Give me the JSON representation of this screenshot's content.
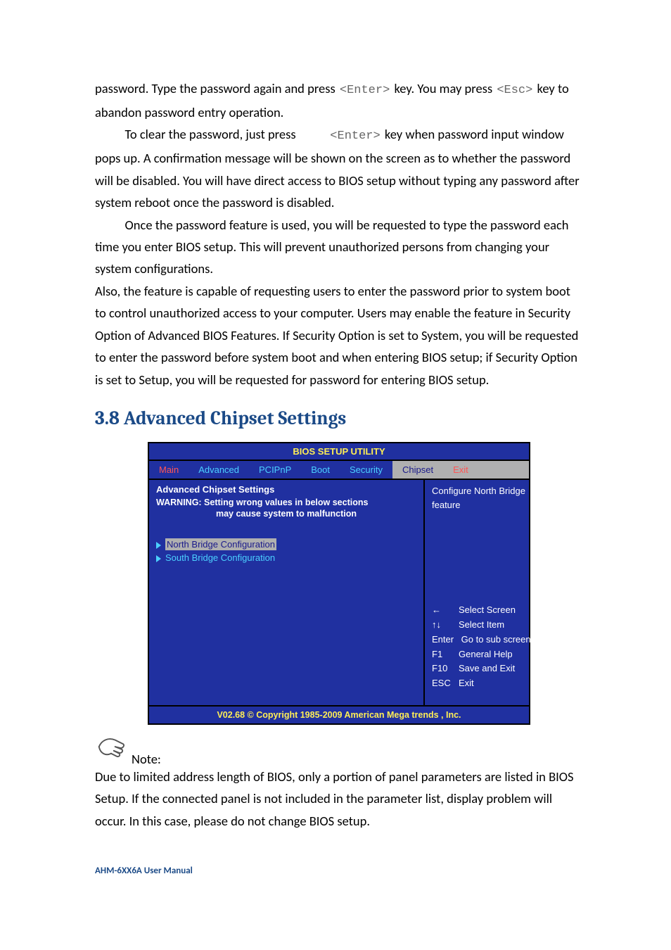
{
  "para1_a": "password. Type the password again and press ",
  "key_enter": "<Enter>",
  "para1_b": " key. You may press ",
  "key_esc": "<Esc>",
  "para1_c": " key to abandon password entry operation.",
  "para2_a": "To clear the password, just press ",
  "para2_b": " key when password input window pops up. A confirmation message will be shown on the screen as to whether the password will be disabled. You will have direct access to BIOS setup without typing any password after system reboot once the password is disabled.",
  "para3": "Once the password feature is used, you will be requested to type the password each time you enter BIOS setup. This will prevent unauthorized persons from changing your system configurations.",
  "para4": "Also, the feature is capable of requesting users to enter the password prior to system boot to control unauthorized access to your computer. Users may enable the feature in Security Option of Advanced BIOS Features. If Security Option is set to System, you will be requested to enter the password before system boot and when entering BIOS setup; if Security Option is set to Setup, you will be requested for password for entering BIOS setup.",
  "heading": "3.8 Advanced Chipset Settings",
  "bios": {
    "title": "BIOS SETUP UTILITY",
    "tabs": {
      "main": "Main",
      "advanced": "Advanced",
      "pcipnp": "PCIPnP",
      "boot": "Boot",
      "security": "Security",
      "chipset": "Chipset",
      "exit": "Exit"
    },
    "left": {
      "section": "Advanced Chipset Settings",
      "warn1": "WARNING: Setting wrong values in below sections",
      "warn2": "may cause system to malfunction",
      "item1": "North Bridge Configuration",
      "item2": "South Bridge Configuration"
    },
    "right": {
      "desc1": "Configure North Bridge",
      "desc2": "feature"
    },
    "help": {
      "r1k": "←",
      "r1v": "Select Screen",
      "r2k": "↑↓",
      "r2v": "Select Item",
      "r3k": "Enter",
      "r3v": "Go to sub screen",
      "r4k": "F1",
      "r4v": "General Help",
      "r5k": "F10",
      "r5v": "Save and Exit",
      "r6k": "ESC",
      "r6v": "Exit"
    },
    "footer": "V02.68 © Copyright 1985-2009 American Mega trends , Inc."
  },
  "note_label": "Note:",
  "note_body": "Due to limited address length of BIOS, only a portion of panel parameters are listed in BIOS Setup. If the connected panel is not included in the parameter list, display problem will occur. In this case, please do not change BIOS setup.",
  "footer_manual": "AHM-6XX6A User Manual"
}
